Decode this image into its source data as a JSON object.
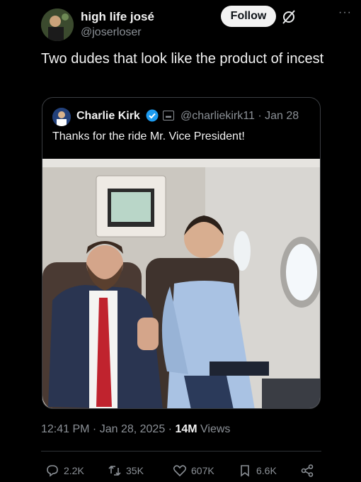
{
  "author": {
    "name": "high life josé",
    "handle": "@joserloser",
    "follow_label": "Follow"
  },
  "post": {
    "text": "Two dudes that look like the product of incest"
  },
  "quoted": {
    "name": "Charlie Kirk",
    "handle_date": "@charliekirk11 · Jan 28",
    "text": "Thanks for the ride Mr. Vice President!"
  },
  "meta": {
    "time_date": "12:41 PM · Jan 28, 2025 · ",
    "views_count": "14M",
    "views_label": " Views"
  },
  "actions": {
    "replies": "2.2K",
    "reposts": "35K",
    "likes": "607K",
    "bookmarks": "6.6K"
  },
  "colors": {
    "background": "#000000",
    "text": "#e7e9ea",
    "muted": "#8b9096",
    "verified": "#1d9bf0"
  }
}
